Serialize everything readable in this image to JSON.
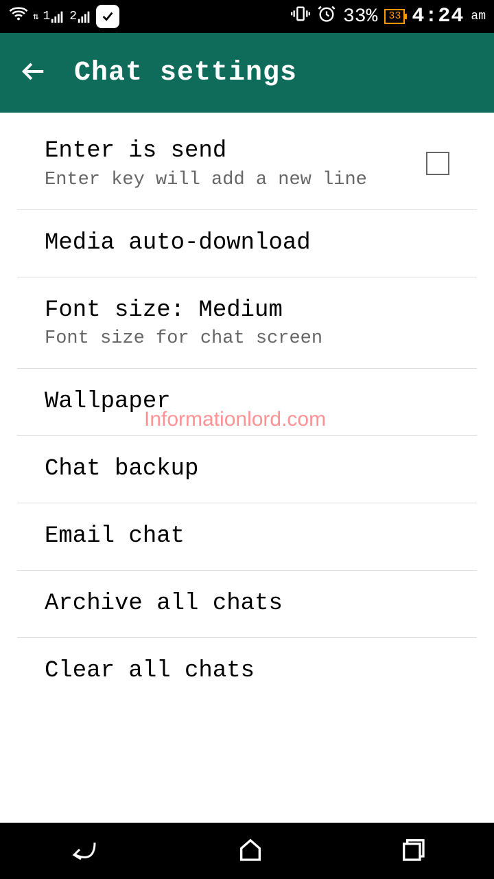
{
  "status_bar": {
    "sim1": "1",
    "sim2": "2",
    "battery_percent": "33%",
    "battery_badge": "33",
    "time": "4:24",
    "ampm": "am"
  },
  "app_bar": {
    "title": "Chat settings"
  },
  "rows": {
    "enter_send": {
      "title": "Enter is send",
      "sub": "Enter key will add a new line"
    },
    "media": {
      "title": "Media auto-download"
    },
    "font": {
      "title": "Font size: Medium",
      "sub": "Font size for chat screen"
    },
    "wallpaper": {
      "title": "Wallpaper"
    },
    "backup": {
      "title": "Chat backup"
    },
    "email": {
      "title": "Email chat"
    },
    "archive": {
      "title": "Archive all chats"
    },
    "clear": {
      "title": "Clear all chats"
    }
  },
  "watermark": "Informationlord.com"
}
